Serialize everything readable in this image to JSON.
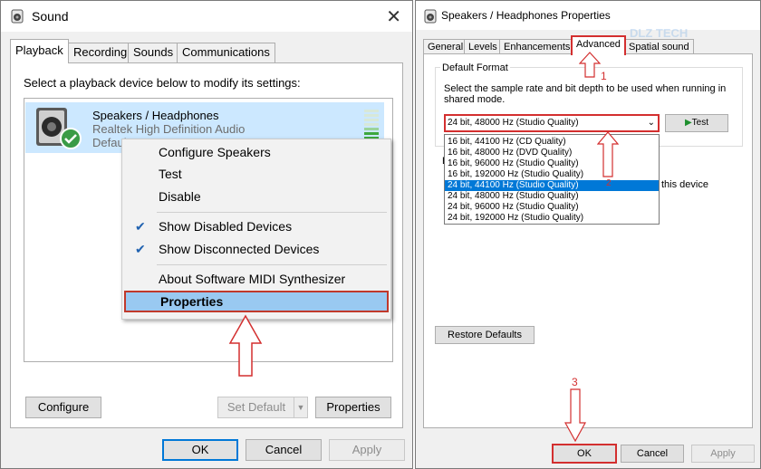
{
  "sound": {
    "title": "Sound",
    "tabs": [
      "Playback",
      "Recording",
      "Sounds",
      "Communications"
    ],
    "instruction": "Select a playback device below to modify its settings:",
    "device": {
      "name": "Speakers / Headphones",
      "driver": "Realtek High Definition Audio",
      "status": "Default"
    },
    "context_menu": {
      "items": [
        {
          "label": "Configure Speakers",
          "checked": false
        },
        {
          "label": "Test",
          "checked": false
        },
        {
          "label": "Disable",
          "checked": false
        },
        {
          "label": "Show Disabled Devices",
          "checked": true
        },
        {
          "label": "Show Disconnected Devices",
          "checked": true
        },
        {
          "label": "About Software MIDI Synthesizer",
          "checked": false
        },
        {
          "label": "Properties",
          "checked": false,
          "highlighted": true
        }
      ]
    },
    "buttons": {
      "configure": "Configure",
      "set_default": "Set Default",
      "properties": "Properties",
      "ok": "OK",
      "cancel": "Cancel",
      "apply": "Apply"
    }
  },
  "props": {
    "title": "Speakers / Headphones Properties",
    "tabs": [
      "General",
      "Levels",
      "Enhancements",
      "Advanced",
      "Spatial sound"
    ],
    "active_tab": "Advanced",
    "default_format_label": "Default Format",
    "format_description": "Select the sample rate and bit depth to be used when running in shared mode.",
    "selected_format": "24 bit, 48000 Hz (Studio Quality)",
    "test_button": "Test",
    "format_options": [
      "16 bit, 44100 Hz (CD Quality)",
      "16 bit, 48000 Hz (DVD Quality)",
      "16 bit, 96000 Hz (Studio Quality)",
      "16 bit, 192000 Hz (Studio Quality)",
      "24 bit, 44100 Hz (Studio Quality)",
      "24 bit, 48000 Hz (Studio Quality)",
      "24 bit, 96000 Hz (Studio Quality)",
      "24 bit, 192000 Hz (Studio Quality)"
    ],
    "highlighted_option_index": 4,
    "hidden_text_fragment": "this device",
    "exclusive_letter": "E",
    "restore_defaults": "Restore Defaults",
    "buttons": {
      "ok": "OK",
      "cancel": "Cancel",
      "apply": "Apply"
    },
    "watermark": "DLZ TECH"
  },
  "annotations": {
    "step1": "1",
    "step2": "2",
    "step3": "3"
  },
  "colors": {
    "accent": "#0078d7",
    "annotation": "#d32f2f",
    "selection": "#99c9f1",
    "check": "#2062b0"
  }
}
